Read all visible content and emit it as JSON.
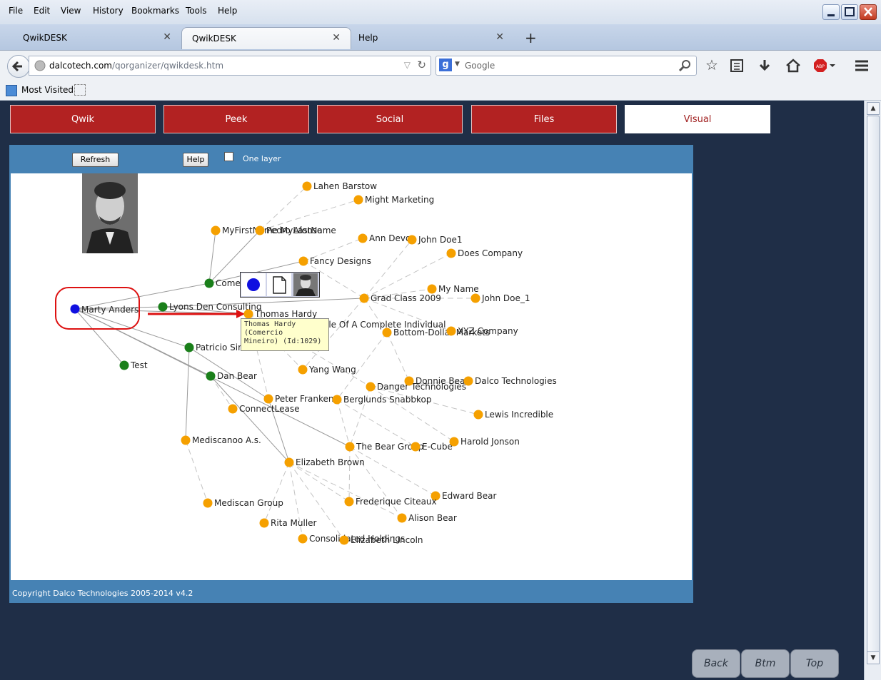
{
  "menu": [
    "File",
    "Edit",
    "View",
    "History",
    "Bookmarks",
    "Tools",
    "Help"
  ],
  "tabs": [
    {
      "label": "QwikDESK"
    },
    {
      "label": "QwikDESK"
    },
    {
      "label": "Help"
    }
  ],
  "address": {
    "domain": "dalcotech.com",
    "path": "/qorganizer/qwikdesk.htm"
  },
  "search": {
    "placeholder": "Google"
  },
  "bookmarks": {
    "most_visited": "Most Visited"
  },
  "nav_tabs": [
    {
      "label": "Qwik",
      "active": false
    },
    {
      "label": "Peek",
      "active": false
    },
    {
      "label": "Social",
      "active": false
    },
    {
      "label": "Files",
      "active": false
    },
    {
      "label": "Visual",
      "active": true
    }
  ],
  "toolbar": {
    "refresh": "Refresh",
    "help": "Help",
    "one_layer": "One layer",
    "one_layer_checked": false
  },
  "graph": {
    "nodes": [
      {
        "id": "n0",
        "label": "Marty Anders",
        "type": "blue"
      },
      {
        "id": "n1",
        "label": "Lyons Den Consulting",
        "type": "green"
      },
      {
        "id": "n2",
        "label": "Comer",
        "type": "green"
      },
      {
        "id": "n3",
        "label": "Patricio Sim",
        "type": "green"
      },
      {
        "id": "n4",
        "label": "Test",
        "type": "green"
      },
      {
        "id": "n5",
        "label": "Dan Bear",
        "type": "green"
      },
      {
        "id": "n6",
        "label": "Thomas Hardy",
        "type": "orange"
      },
      {
        "id": "n7",
        "label": "Lahen Barstow",
        "type": "orange"
      },
      {
        "id": "n8",
        "label": "Might Marketing",
        "type": "orange"
      },
      {
        "id": "n9",
        "label": "MyFirstName MyLastName",
        "type": "orange"
      },
      {
        "id": "n10",
        "label": "Pedro Afonso",
        "type": "orange"
      },
      {
        "id": "n11",
        "label": "Ann Devon",
        "type": "orange"
      },
      {
        "id": "n12",
        "label": "John Doe1",
        "type": "orange"
      },
      {
        "id": "n13",
        "label": "Does Company",
        "type": "orange"
      },
      {
        "id": "n14",
        "label": "Fancy Designs",
        "type": "orange"
      },
      {
        "id": "n15",
        "label": "Grad Class 2009",
        "type": "orange"
      },
      {
        "id": "n16",
        "label": "My Name",
        "type": "orange"
      },
      {
        "id": "n17",
        "label": "John Doe_1",
        "type": "orange"
      },
      {
        "id": "n18",
        "label": "Example Of A Complete Individual",
        "type": "orange"
      },
      {
        "id": "n19",
        "label": "Bottom-Dollar Markets",
        "type": "orange"
      },
      {
        "id": "n20",
        "label": "XYZ Company",
        "type": "orange"
      },
      {
        "id": "n21",
        "label": "Yang Wang",
        "type": "orange"
      },
      {
        "id": "n22",
        "label": "Danger Technologies",
        "type": "orange"
      },
      {
        "id": "n23",
        "label": "Donnie Bear",
        "type": "orange"
      },
      {
        "id": "n24",
        "label": "Dalco Technologies",
        "type": "orange"
      },
      {
        "id": "n25",
        "label": "Peter Franken",
        "type": "orange"
      },
      {
        "id": "n26",
        "label": "Berglunds Snabbkop",
        "type": "orange"
      },
      {
        "id": "n27",
        "label": "ConnectLease",
        "type": "orange"
      },
      {
        "id": "n28",
        "label": "Lewis Incredible",
        "type": "orange"
      },
      {
        "id": "n29",
        "label": "Mediscanoo A.s.",
        "type": "orange"
      },
      {
        "id": "n30",
        "label": "The Bear Group",
        "type": "orange"
      },
      {
        "id": "n31",
        "label": "E-Cube",
        "type": "orange"
      },
      {
        "id": "n32",
        "label": "Harold Jonson",
        "type": "orange"
      },
      {
        "id": "n33",
        "label": "Elizabeth Brown",
        "type": "orange"
      },
      {
        "id": "n34",
        "label": "Edward Bear",
        "type": "orange"
      },
      {
        "id": "n35",
        "label": "Mediscan Group",
        "type": "orange"
      },
      {
        "id": "n36",
        "label": "Frederique Citeaux",
        "type": "orange"
      },
      {
        "id": "n37",
        "label": "Alison Bear",
        "type": "orange"
      },
      {
        "id": "n38",
        "label": "Rita Muller",
        "type": "orange"
      },
      {
        "id": "n39",
        "label": "Consolidated Holdings",
        "type": "orange"
      },
      {
        "id": "n40",
        "label": "Elizabeth Lincoln",
        "type": "orange"
      }
    ],
    "edges": [
      [
        "n0",
        "n1",
        "solid"
      ],
      [
        "n0",
        "n2",
        "solid"
      ],
      [
        "n0",
        "n3",
        "solid"
      ],
      [
        "n0",
        "n4",
        "solid"
      ],
      [
        "n0",
        "n5",
        "solid"
      ],
      [
        "n0",
        "n6",
        "solid"
      ],
      [
        "n0",
        "n30",
        "solid"
      ],
      [
        "n2",
        "n9",
        "solid"
      ],
      [
        "n2",
        "n10",
        "solid"
      ],
      [
        "n2",
        "n14",
        "solid"
      ],
      [
        "n1",
        "n6",
        "solid"
      ],
      [
        "n1",
        "n15",
        "solid"
      ],
      [
        "n3",
        "n29",
        "solid"
      ],
      [
        "n3",
        "n25",
        "solid"
      ],
      [
        "n5",
        "n27",
        "dashed"
      ],
      [
        "n5",
        "n33",
        "solid"
      ],
      [
        "n10",
        "n7",
        "dashed"
      ],
      [
        "n10",
        "n8",
        "dashed"
      ],
      [
        "n14",
        "n11",
        "dashed"
      ],
      [
        "n14",
        "n15",
        "dashed"
      ],
      [
        "n15",
        "n12",
        "dashed"
      ],
      [
        "n15",
        "n13",
        "dashed"
      ],
      [
        "n15",
        "n16",
        "dashed"
      ],
      [
        "n15",
        "n17",
        "dashed"
      ],
      [
        "n15",
        "n20",
        "dashed"
      ],
      [
        "n15",
        "n19",
        "dashed"
      ],
      [
        "n15",
        "n21",
        "dashed"
      ],
      [
        "n6",
        "n18",
        "dashed"
      ],
      [
        "n6",
        "n21",
        "dashed"
      ],
      [
        "n6",
        "n22",
        "dashed"
      ],
      [
        "n6",
        "n25",
        "dashed"
      ],
      [
        "n19",
        "n23",
        "dashed"
      ],
      [
        "n19",
        "n26",
        "dashed"
      ],
      [
        "n22",
        "n24",
        "dashed"
      ],
      [
        "n22",
        "n28",
        "dashed"
      ],
      [
        "n22",
        "n30",
        "dashed"
      ],
      [
        "n22",
        "n32",
        "dashed"
      ],
      [
        "n26",
        "n31",
        "dashed"
      ],
      [
        "n26",
        "n30",
        "dashed"
      ],
      [
        "n30",
        "n34",
        "dashed"
      ],
      [
        "n30",
        "n37",
        "dashed"
      ],
      [
        "n30",
        "n36",
        "dashed"
      ],
      [
        "n29",
        "n35",
        "dashed"
      ],
      [
        "n33",
        "n36",
        "dashed"
      ],
      [
        "n33",
        "n38",
        "dashed"
      ],
      [
        "n33",
        "n39",
        "dashed"
      ],
      [
        "n33",
        "n40",
        "dashed"
      ],
      [
        "n33",
        "n37",
        "dashed"
      ],
      [
        "n25",
        "n33",
        "solid"
      ]
    ]
  },
  "tooltip": {
    "lines": [
      "Thomas Hardy",
      "(Comercio",
      "Mineiro) (Id:1029)"
    ]
  },
  "footer": {
    "copyright": "Copyright Dalco Technologies 2005-2014  v4.2"
  },
  "bottom_buttons": [
    "Back",
    "Btm",
    "Top"
  ],
  "colors": {
    "nav_tab_red": "#b22222",
    "panel_blue": "#4682b4",
    "node_orange": "#f5a000",
    "node_green": "#1a7f1a",
    "node_blue": "#1010e0",
    "highlight_red": "#dd1111"
  }
}
